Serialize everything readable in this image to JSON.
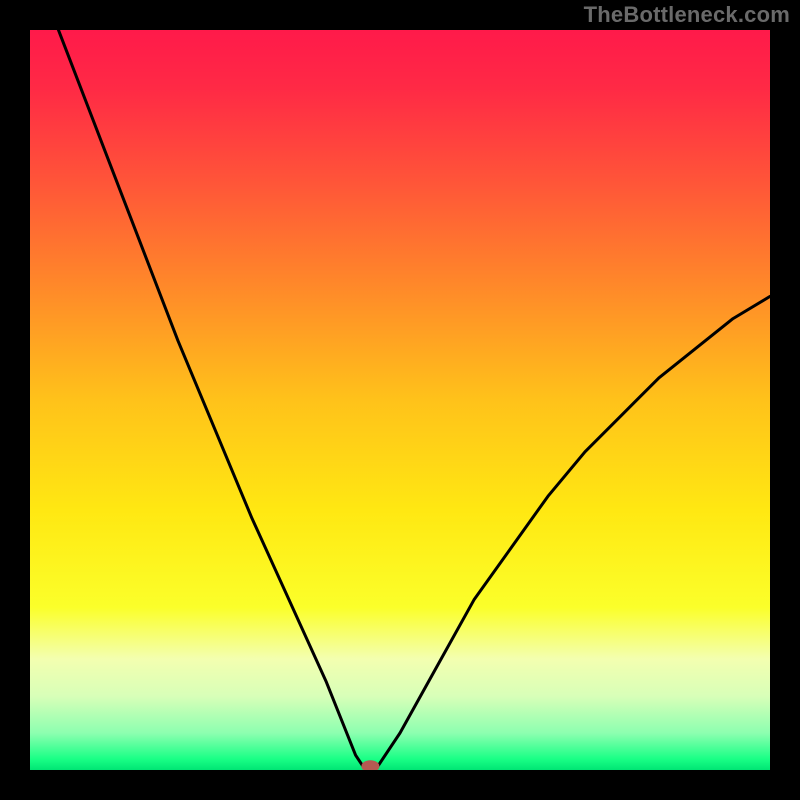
{
  "watermark": "TheBottleneck.com",
  "chart_data": {
    "type": "line",
    "title": "",
    "xlabel": "",
    "ylabel": "",
    "xlim": [
      0,
      100
    ],
    "ylim": [
      0,
      100
    ],
    "series": [
      {
        "name": "curve",
        "x": [
          0,
          5,
          10,
          15,
          20,
          25,
          30,
          35,
          40,
          42,
          44,
          45,
          47,
          50,
          55,
          60,
          65,
          70,
          75,
          80,
          85,
          90,
          95,
          100
        ],
        "y": [
          110,
          97,
          84,
          71,
          58,
          46,
          34,
          23,
          12,
          7,
          2,
          0.5,
          0.5,
          5,
          14,
          23,
          30,
          37,
          43,
          48,
          53,
          57,
          61,
          64
        ]
      }
    ],
    "marker": {
      "x": 46,
      "y": 0.5
    },
    "gradient_stops": [
      {
        "offset": 0.0,
        "color": "#ff1a4a"
      },
      {
        "offset": 0.08,
        "color": "#ff2a45"
      },
      {
        "offset": 0.2,
        "color": "#ff5339"
      },
      {
        "offset": 0.35,
        "color": "#ff8a29"
      },
      {
        "offset": 0.5,
        "color": "#ffc21a"
      },
      {
        "offset": 0.65,
        "color": "#ffe812"
      },
      {
        "offset": 0.78,
        "color": "#fbff2a"
      },
      {
        "offset": 0.85,
        "color": "#f3ffb0"
      },
      {
        "offset": 0.9,
        "color": "#d8ffb8"
      },
      {
        "offset": 0.95,
        "color": "#8dffb0"
      },
      {
        "offset": 0.985,
        "color": "#1aff86"
      },
      {
        "offset": 1.0,
        "color": "#00e574"
      }
    ]
  }
}
